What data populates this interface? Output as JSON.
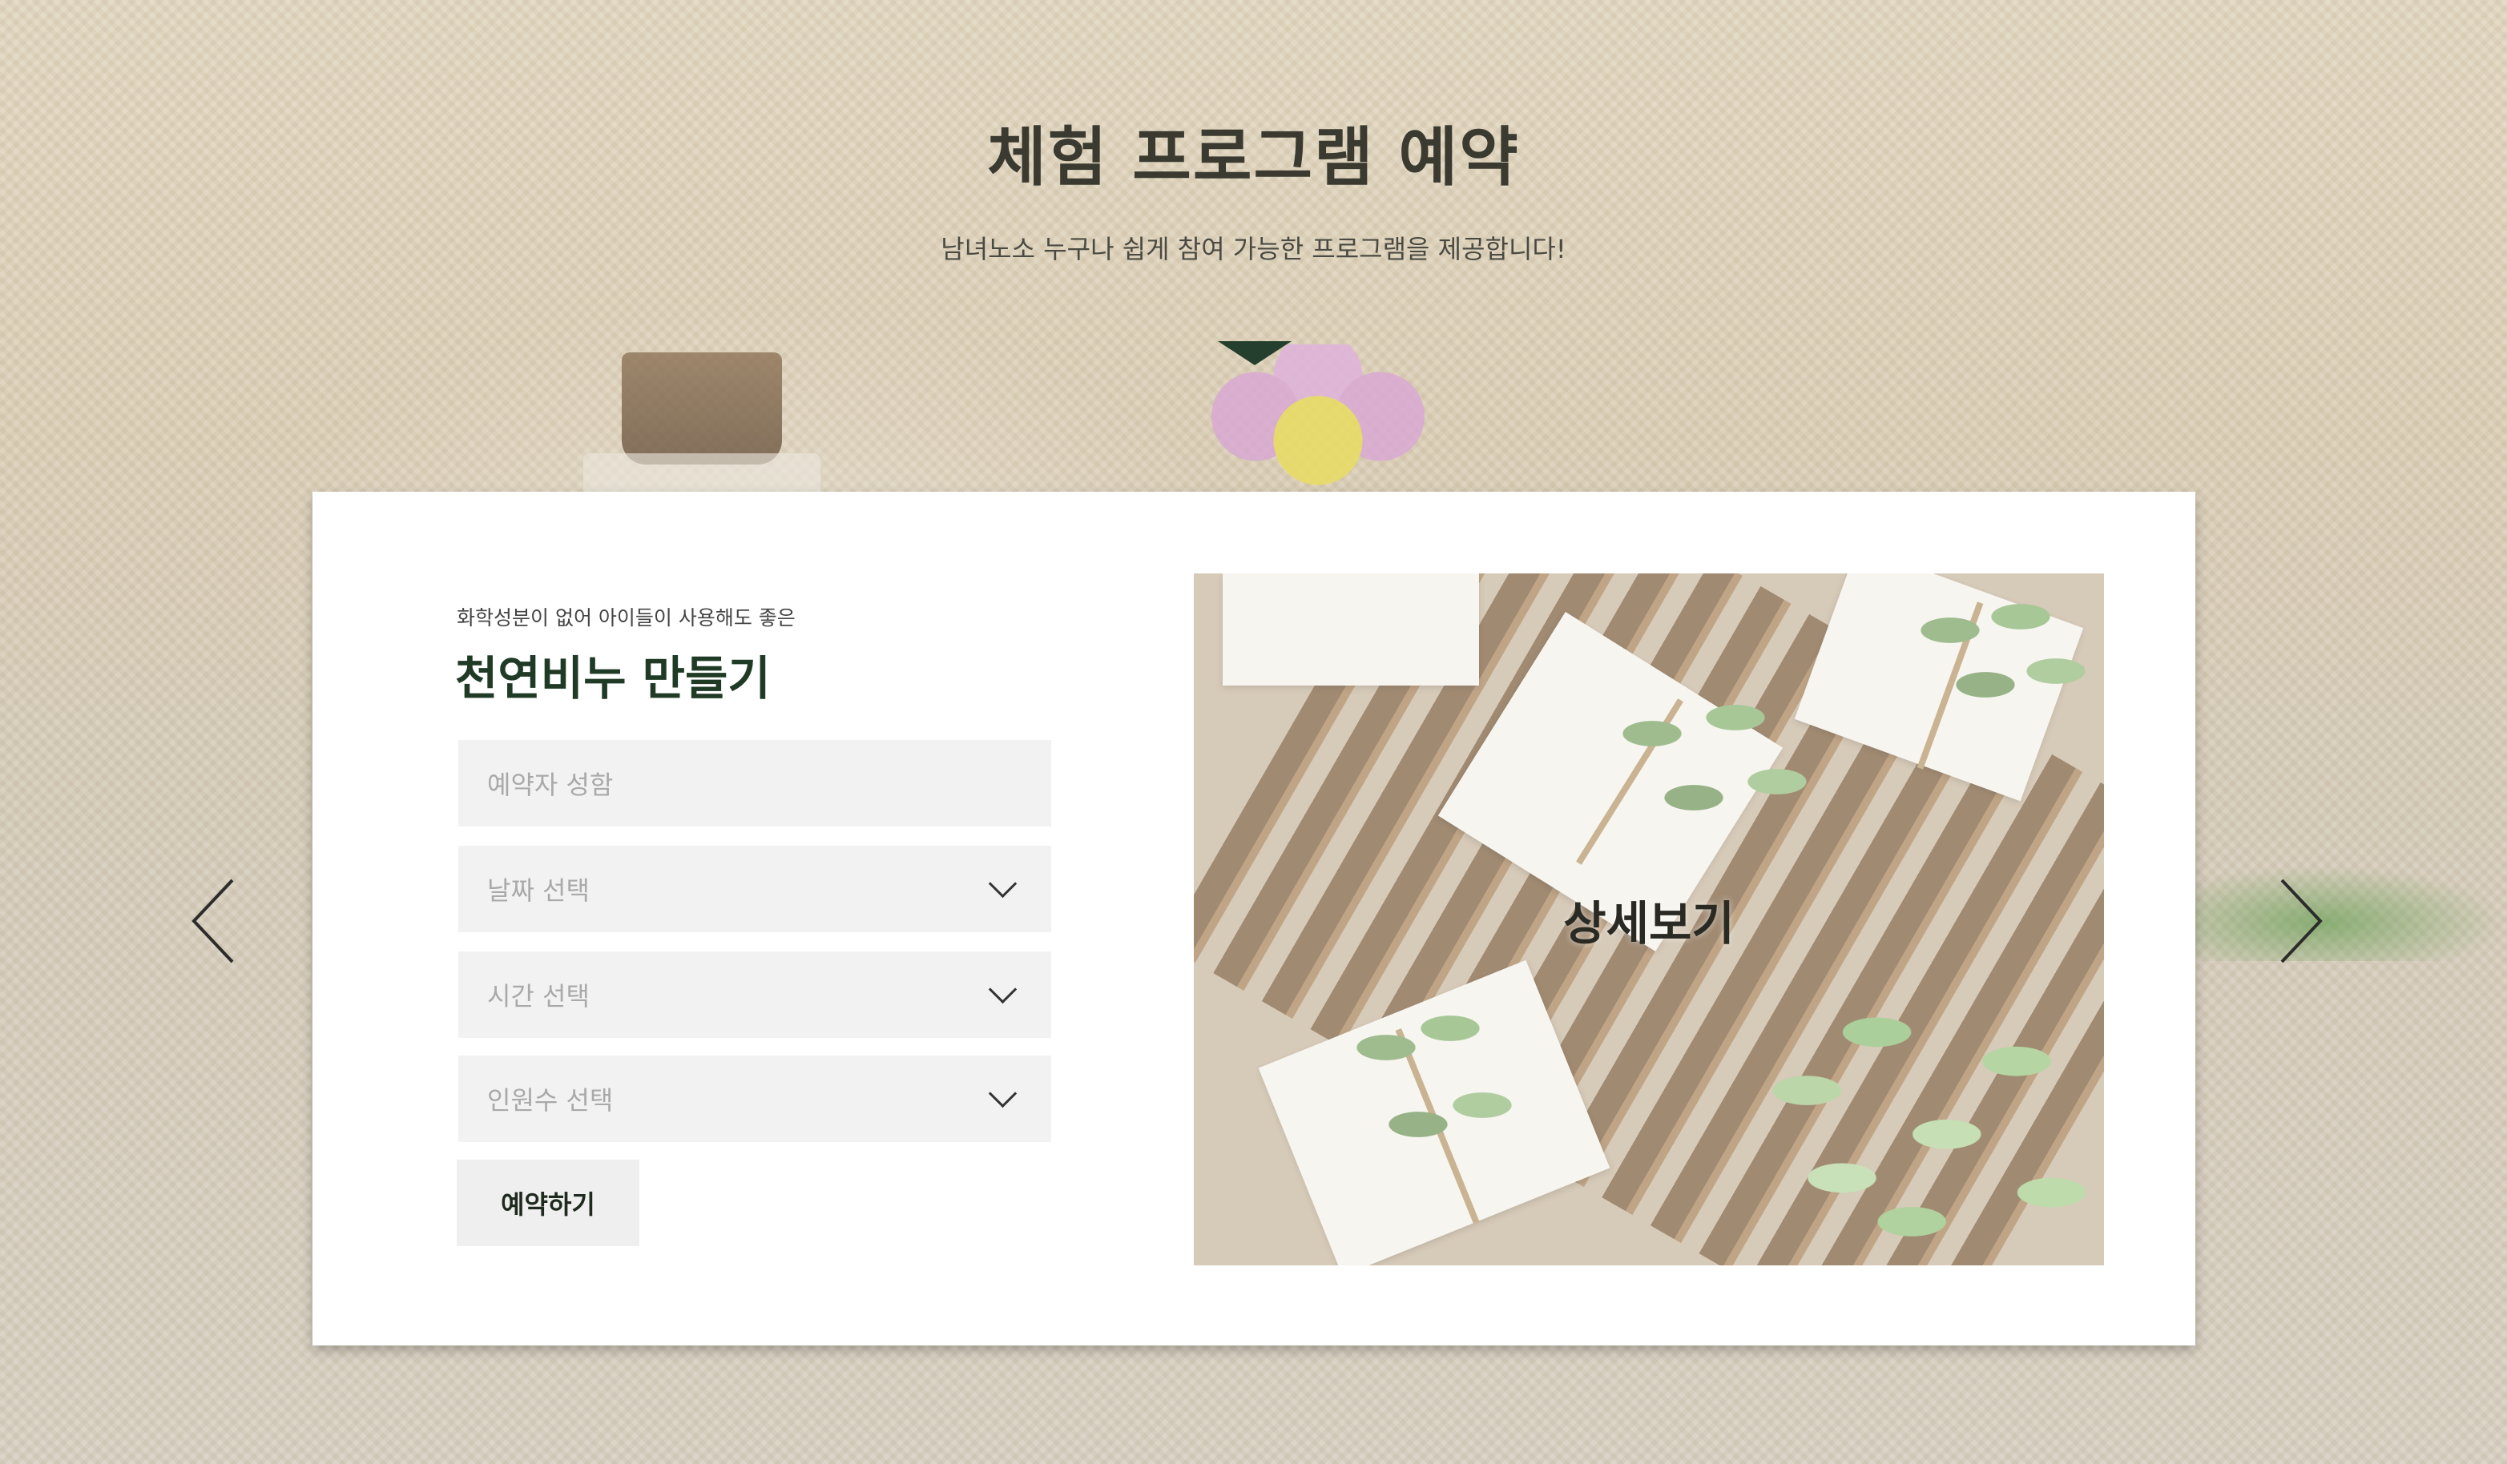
{
  "header": {
    "title": "체험 프로그램 예약",
    "subtitle": "남녀노소 누구나 쉽게 참여 가능한 프로그램을 제공합니다!"
  },
  "card": {
    "eyebrow": "화학성분이 없어 아이들이 사용해도 좋은",
    "title": "천연비누 만들기",
    "form": {
      "name_placeholder": "예약자 성함",
      "date_placeholder": "날짜 선택",
      "time_placeholder": "시간 선택",
      "people_placeholder": "인원수 선택",
      "submit_label": "예약하기"
    },
    "image": {
      "detail_label": "상세보기"
    }
  },
  "icons": {
    "prev": "chevron-left-icon",
    "next": "chevron-right-icon",
    "dropdown": "chevron-down-icon"
  },
  "colors": {
    "accent_dark_green": "#243f2d",
    "title_green": "#1f3a25",
    "field_bg": "#f2f2f2"
  }
}
